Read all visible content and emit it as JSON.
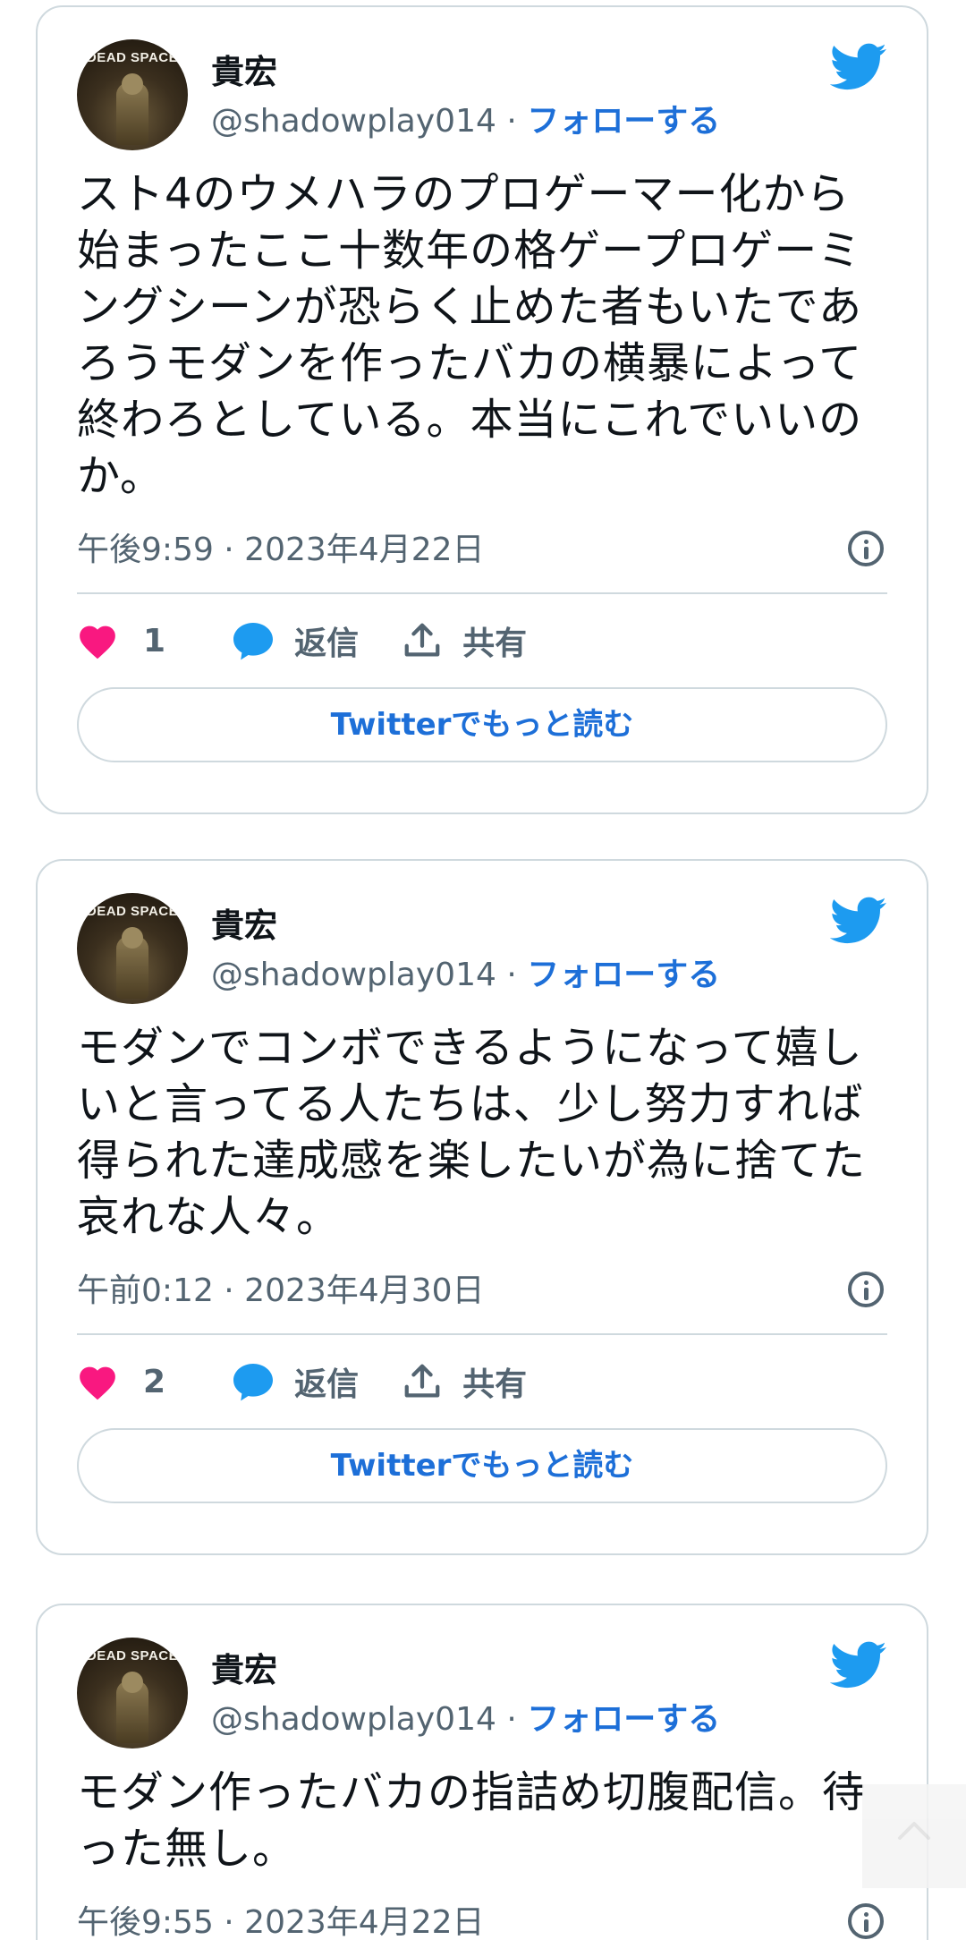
{
  "colors": {
    "accent": "#1d6fd8",
    "twitter_blue": "#1d9bf0",
    "like_pink": "#f91880",
    "border": "#cfd9de",
    "muted": "#536471"
  },
  "tweets": [
    {
      "avatar_text": "DEAD SPACE",
      "name": "貴宏",
      "handle": "@shadowplay014",
      "separator": " · ",
      "follow_label": "フォローする",
      "text": "スト4のウメハラのプロゲーマー化から始まったここ十数年の格ゲープロゲーミングシーンが恐らく止めた者もいたであろうモダンを作ったバカの横暴によって終わろとしている。本当にこれでいいのか。",
      "timestamp": "午後9:59 · 2023年4月22日",
      "likes": "1",
      "reply_label": "返信",
      "share_label": "共有",
      "read_more_label": "Twitterでもっと読む"
    },
    {
      "avatar_text": "DEAD SPACE",
      "name": "貴宏",
      "handle": "@shadowplay014",
      "separator": " · ",
      "follow_label": "フォローする",
      "text": "モダンでコンボできるようになって嬉しいと言ってる人たちは、少し努力すれば得られた達成感を楽したいが為に捨てた哀れな人々。",
      "timestamp": "午前0:12 · 2023年4月30日",
      "likes": "2",
      "reply_label": "返信",
      "share_label": "共有",
      "read_more_label": "Twitterでもっと読む"
    },
    {
      "avatar_text": "DEAD SPACE",
      "name": "貴宏",
      "handle": "@shadowplay014",
      "separator": " · ",
      "follow_label": "フォローする",
      "text": "モダン作ったバカの指詰め切腹配信。待った無し。",
      "timestamp": "午後9:55 · 2023年4月22日"
    }
  ],
  "icons": {
    "twitter": "twitter-bird-icon",
    "like": "heart-icon",
    "reply": "speech-bubble-icon",
    "share": "share-upload-icon",
    "info": "info-icon",
    "scroll_top": "chevron-up-icon"
  }
}
